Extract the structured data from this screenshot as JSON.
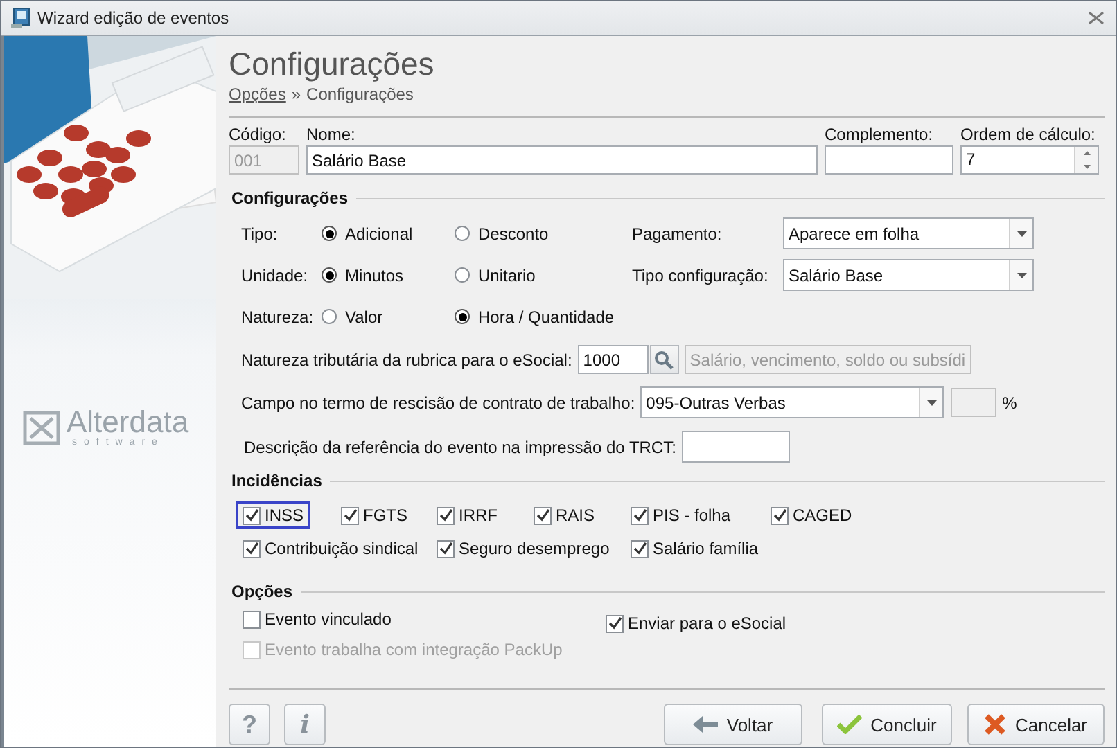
{
  "window": {
    "title": "Wizard edição de eventos"
  },
  "sidebar": {
    "logo": {
      "name": "Alterdata",
      "tagline": "software"
    }
  },
  "header": {
    "title": "Configurações",
    "breadcrumb": {
      "link": "Opções",
      "separator": "»",
      "current": "Configurações"
    }
  },
  "fields": {
    "codigo": {
      "label": "Código:",
      "value": "001",
      "disabled": true
    },
    "nome": {
      "label": "Nome:",
      "value": "Salário Base"
    },
    "complemento": {
      "label": "Complemento:"
    },
    "ordem": {
      "label": "Ordem de cálculo:",
      "value": "7"
    }
  },
  "configuracoes": {
    "title": "Configurações",
    "radio_rows": [
      {
        "label": "Tipo:",
        "options": [
          {
            "label": "Adicional",
            "selected": true
          },
          {
            "label": "Desconto",
            "selected": false
          }
        ],
        "select": {
          "label": "Pagamento:",
          "value": "Aparece em folha"
        }
      },
      {
        "label": "Unidade:",
        "options": [
          {
            "label": "Minutos",
            "selected": true
          },
          {
            "label": "Unitario",
            "selected": false
          }
        ],
        "select": {
          "label": "Tipo configuração:",
          "value": "Salário Base"
        }
      },
      {
        "label": "Natureza:",
        "options": [
          {
            "label": "Valor",
            "selected": false
          },
          {
            "label": "Hora / Quantidade",
            "selected": true
          }
        ]
      }
    ],
    "natureza_tributaria": {
      "label": "Natureza tributária da rubrica para o eSocial:",
      "value": "1000",
      "description": "Salário, vencimento, soldo ou subsídi"
    },
    "campo_rescisao": {
      "label": "Campo no termo de rescisão de contrato de trabalho:",
      "value": "095-Outras Verbas",
      "suffix": "%"
    },
    "descricao_trct": {
      "label": "Descrição da referência do evento na impressão do TRCT:"
    }
  },
  "incidencias": {
    "title": "Incidências",
    "rows": [
      [
        {
          "label": "INSS",
          "checked": true,
          "focused": true
        },
        {
          "label": "FGTS",
          "checked": true,
          "focused": false
        },
        {
          "label": "IRRF",
          "checked": true,
          "focused": false
        },
        {
          "label": "RAIS",
          "checked": true,
          "focused": false
        },
        {
          "label": "PIS - folha",
          "checked": true,
          "focused": false
        },
        {
          "label": "CAGED",
          "checked": true,
          "focused": false
        }
      ],
      [
        {
          "label": "Contribuição sindical",
          "checked": true,
          "focused": false
        },
        "",
        {
          "label": "Seguro desemprego",
          "checked": true,
          "focused": false
        },
        "",
        {
          "label": "Salário família",
          "checked": true,
          "focused": false
        }
      ]
    ]
  },
  "opcoes": {
    "title": "Opções",
    "items": [
      {
        "label": "Evento vinculado",
        "checked": false,
        "disabled": false
      },
      {
        "label": "Enviar para o eSocial",
        "checked": true,
        "disabled": false
      },
      {
        "label": "Evento trabalha com integração PackUp",
        "checked": false,
        "disabled": true
      }
    ]
  },
  "buttons": [
    {
      "kind": "help",
      "label": "?"
    },
    {
      "kind": "info",
      "label": "i"
    },
    {
      "kind": "back",
      "label": "Voltar"
    },
    {
      "kind": "finish",
      "label": "Concluir"
    },
    {
      "kind": "cancel",
      "label": "Cancelar"
    }
  ]
}
